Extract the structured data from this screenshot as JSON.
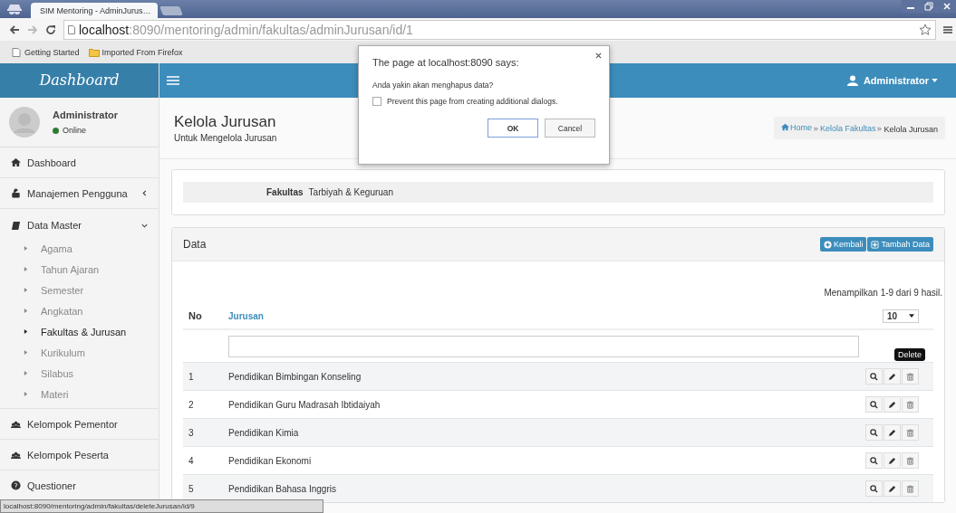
{
  "browser": {
    "tab_title": "SIM Mentoring - AdminJurus…",
    "url_host": "localhost",
    "url_path": ":8090/mentoring/admin/fakultas/adminJurusan/id/1",
    "bookmarks": [
      "Getting Started",
      "Imported From Firefox"
    ],
    "status_url": "localhost:8090/mentoring/admin/fakultas/deleteJurusan/id/9"
  },
  "dialog": {
    "title": "The page at localhost:8090 says:",
    "message": "Anda yakin akan menghapus data?",
    "checkbox_label": "Prevent this page from creating additional dialogs.",
    "checked": false,
    "buttons": [
      "OK",
      "Cancel"
    ]
  },
  "header": {
    "logo": "Dashboard",
    "user_menu": "Administrator"
  },
  "sidebar": {
    "user": {
      "name": "Administrator",
      "status": "Online"
    },
    "items": [
      {
        "label": "Dashboard"
      },
      {
        "label": "Manajemen Pengguna",
        "expanded": false
      },
      {
        "label": "Data Master",
        "expanded": true,
        "children": [
          {
            "label": "Agama",
            "selected": false
          },
          {
            "label": "Tahun Ajaran",
            "selected": false
          },
          {
            "label": "Semester",
            "selected": false
          },
          {
            "label": "Angkatan",
            "selected": false
          },
          {
            "label": "Fakultas & Jurusan",
            "selected": true
          },
          {
            "label": "Kurikulum",
            "selected": false
          },
          {
            "label": "Silabus",
            "selected": false
          },
          {
            "label": "Materi",
            "selected": false
          }
        ]
      },
      {
        "label": "Kelompok Pementor"
      },
      {
        "label": "Kelompok Peserta"
      },
      {
        "label": "Questioner"
      }
    ]
  },
  "page": {
    "title": "Kelola Jurusan",
    "subtitle": "Untuk Mengelola Jurusan",
    "breadcrumb": [
      "Home",
      "Kelola Fakultas",
      "Kelola Jurusan"
    ]
  },
  "faculty": {
    "label": "Fakultas",
    "value": "Tarbiyah & Keguruan"
  },
  "data_box": {
    "title": "Data",
    "buttons": [
      "Kembali",
      "Tambah Data"
    ],
    "summary": "Menampilkan 1-9 dari 9 hasil.",
    "page_size": "10",
    "columns": [
      "No",
      "Jurusan"
    ],
    "rows": [
      {
        "no": "1",
        "name": "Pendidikan Bimbingan Konseling",
        "tooltip": "Delete"
      },
      {
        "no": "2",
        "name": "Pendidikan Guru Madrasah Ibtidaiyah"
      },
      {
        "no": "3",
        "name": "Pendidikan Kimia"
      },
      {
        "no": "4",
        "name": "Pendidikan Ekonomi"
      },
      {
        "no": "5",
        "name": "Pendidikan Bahasa Inggris"
      }
    ]
  }
}
